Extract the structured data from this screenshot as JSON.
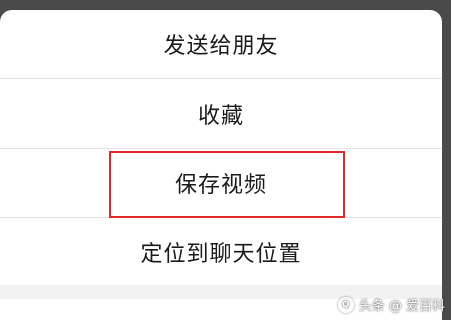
{
  "menu": {
    "items": [
      {
        "label": "发送给朋友"
      },
      {
        "label": "收藏"
      },
      {
        "label": "保存视频"
      },
      {
        "label": "定位到聊天位置"
      }
    ]
  },
  "watermark": {
    "text": "头条 @ 爱百科",
    "logo_glyph": "Q"
  },
  "colors": {
    "backdrop": "#4a4a4a",
    "sheet": "#ffffff",
    "highlight": "#e02a2a",
    "text": "#1a1a1a"
  }
}
